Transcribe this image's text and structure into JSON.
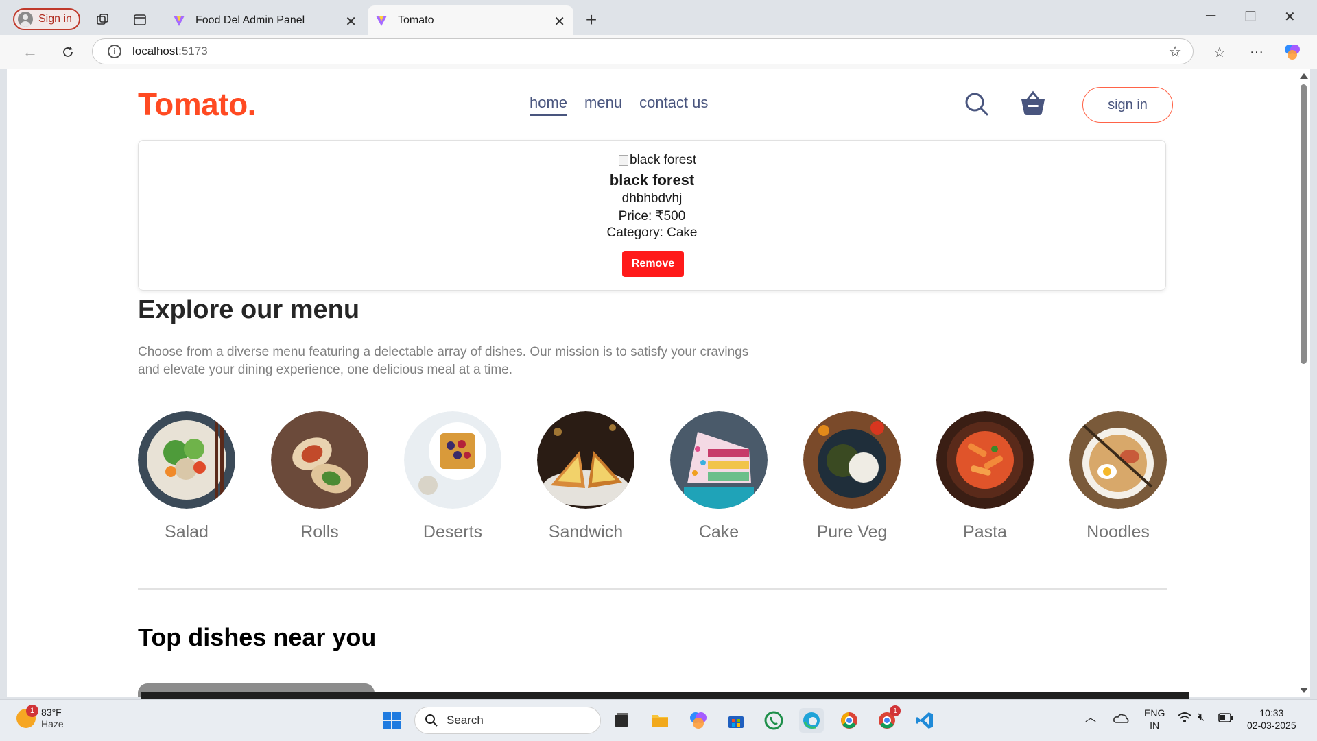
{
  "browser": {
    "profile_label": "Sign in",
    "tabs": [
      {
        "title": "Food Del Admin Panel",
        "active": false
      },
      {
        "title": "Tomato",
        "active": true
      }
    ],
    "url_host": "localhost",
    "url_port": ":5173"
  },
  "navbar": {
    "logo": "Tomato.",
    "links": [
      "home",
      "menu",
      "contact us"
    ],
    "active_link": "home",
    "signin_label": "sign in"
  },
  "food_card": {
    "image_alt": "black forest",
    "name": "black forest",
    "description": "dhbhbdvhj",
    "price_line": "Price: ₹500",
    "category_line": "Category: Cake",
    "remove_label": "Remove"
  },
  "explore": {
    "title": "Explore our menu",
    "text": "Choose from a diverse menu featuring a delectable array of dishes. Our mission is to satisfy your cravings and elevate your dining experience, one delicious meal at a time."
  },
  "menu_items": [
    {
      "label": "Salad"
    },
    {
      "label": "Rolls"
    },
    {
      "label": "Deserts"
    },
    {
      "label": "Sandwich"
    },
    {
      "label": "Cake"
    },
    {
      "label": "Pure Veg"
    },
    {
      "label": "Pasta"
    },
    {
      "label": "Noodles"
    }
  ],
  "top_dishes": {
    "title": "Top dishes near you"
  },
  "taskbar": {
    "weather_temp": "83°F",
    "weather_desc": "Haze",
    "weather_badge": "1",
    "search_label": "Search",
    "chrome_badge": "1",
    "lang_line1": "ENG",
    "lang_line2": "IN",
    "time": "10:33",
    "date": "02-03-2025"
  },
  "colors": {
    "brand": "#ff4a22",
    "nav_text": "#49557e",
    "remove_button": "#ff1a1a"
  }
}
